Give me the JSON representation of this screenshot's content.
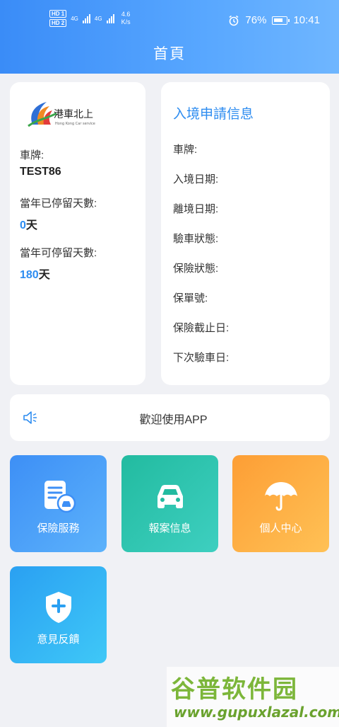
{
  "status_bar": {
    "hd1": "HD 1",
    "hd2": "HD 2",
    "net1": "4G",
    "net2": "4G",
    "speed_value": "4.6",
    "speed_unit": "K/s",
    "battery": "76%",
    "time": "10:41"
  },
  "header": {
    "title": "首頁"
  },
  "vehicle_card": {
    "logo_icon": "hk-vehicle-northbound-logo",
    "plate_label": "車牌:",
    "plate_value": "TEST86",
    "days_stayed_label": "當年已停留天數:",
    "days_stayed_number": "0",
    "days_stayed_unit": "天",
    "days_allowed_label": "當年可停留天數:",
    "days_allowed_number": "180",
    "days_allowed_unit": "天"
  },
  "entry_info": {
    "title": "入境申請信息",
    "rows": [
      "車牌:",
      "入境日期:",
      "離境日期:",
      "驗車狀態:",
      "保險狀態:",
      "保單號:",
      "保險截止日:",
      "下次驗車日:"
    ]
  },
  "notice": {
    "icon": "speaker-icon",
    "message": "歡迎使用APP"
  },
  "tiles": [
    {
      "label": "保險服務",
      "icon": "insurance-document-icon",
      "color": "#3d8ff6"
    },
    {
      "label": "報案信息",
      "icon": "car-icon",
      "color": "#22bba0"
    },
    {
      "label": "個人中心",
      "icon": "umbrella-icon",
      "color": "#fd9e35"
    },
    {
      "label": "意見反饋",
      "icon": "shield-plus-icon",
      "color": "#2aa0f2"
    }
  ],
  "watermark": {
    "name": "谷普软件园",
    "url": "www.gupuxlazal.com"
  }
}
